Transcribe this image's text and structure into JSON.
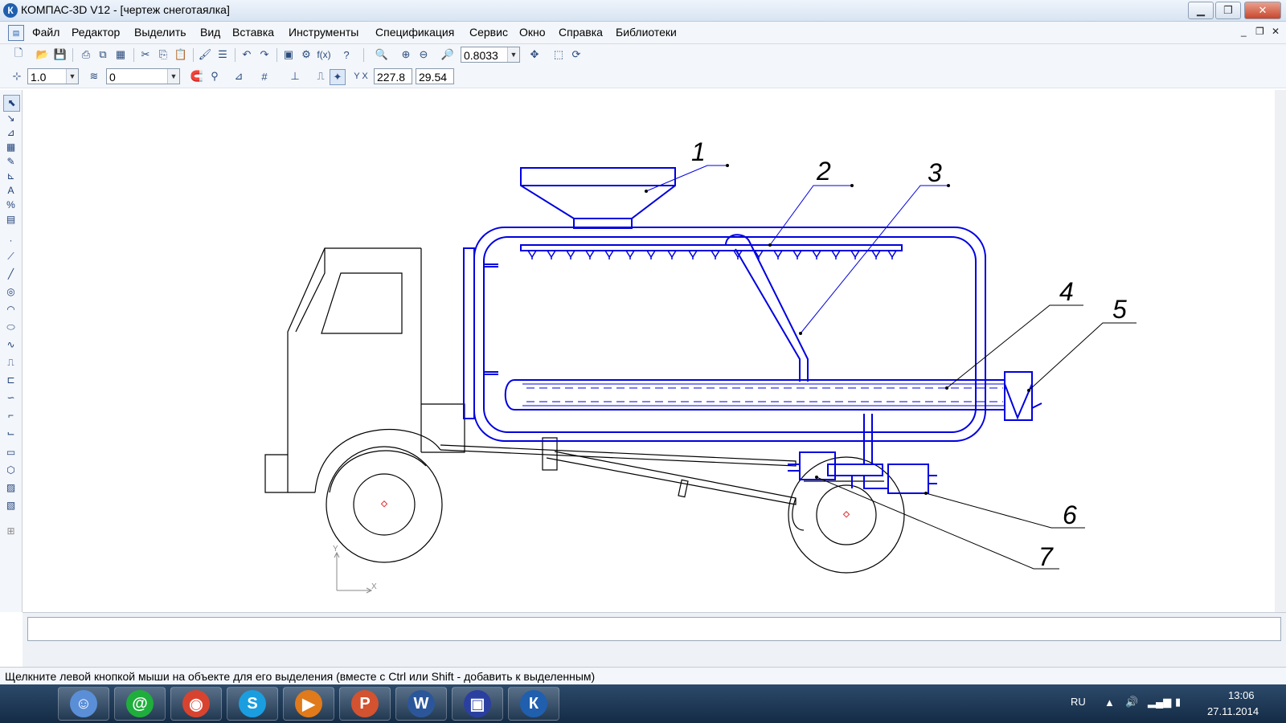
{
  "window": {
    "title": "КОМПАС-3D V12 - [чертеж снеготаялка]",
    "app_icon": "К",
    "controls": {
      "minimize": "▁",
      "maximize": "❐",
      "close": "✕"
    }
  },
  "menu": {
    "items": [
      "Файл",
      "Редактор",
      "Выделить",
      "Вид",
      "Вставка",
      "Инструменты",
      "Спецификация",
      "Сервис",
      "Окно",
      "Справка",
      "Библиотеки"
    ],
    "mdi_controls": {
      "minimize": "_",
      "restore": "❐",
      "close": "✕"
    }
  },
  "toolbar1": {
    "zoom_value": "0.8033"
  },
  "toolbar2": {
    "step_value": "1.0",
    "layer_value": "0",
    "coord_x": "227.8",
    "coord_y": "29.54"
  },
  "drawing": {
    "callouts": [
      "1",
      "2",
      "3",
      "4",
      "5",
      "6",
      "7"
    ],
    "axis_x": "X",
    "axis_y": "Y",
    "line_color": "#0000e0",
    "outline_color": "#000000",
    "center_mark_color": "#e03030"
  },
  "status": {
    "message": "Щелкните левой кнопкой мыши на объекте для его выделения (вместе с Ctrl или Shift - добавить к выделенным)"
  },
  "taskbar": {
    "apps": [
      {
        "name": "finder-icon",
        "color": "#5a8fd8",
        "glyph": "☺"
      },
      {
        "name": "mail-agent-icon",
        "color": "#1fae3c",
        "glyph": "@"
      },
      {
        "name": "chrome-icon",
        "color": "#d8432f",
        "glyph": "◉"
      },
      {
        "name": "skype-icon",
        "color": "#1a9ee0",
        "glyph": "S"
      },
      {
        "name": "media-player-icon",
        "color": "#e07a1a",
        "glyph": "▶"
      },
      {
        "name": "powerpoint-icon",
        "color": "#d35230",
        "glyph": "P"
      },
      {
        "name": "word-icon",
        "color": "#2b579a",
        "glyph": "W"
      },
      {
        "name": "save-disk-icon",
        "color": "#2a3fa0",
        "glyph": "▣"
      },
      {
        "name": "kompas-icon",
        "color": "#1f5fae",
        "glyph": "К"
      }
    ],
    "language": "RU",
    "time": "13:06",
    "date": "27.11.2014"
  }
}
